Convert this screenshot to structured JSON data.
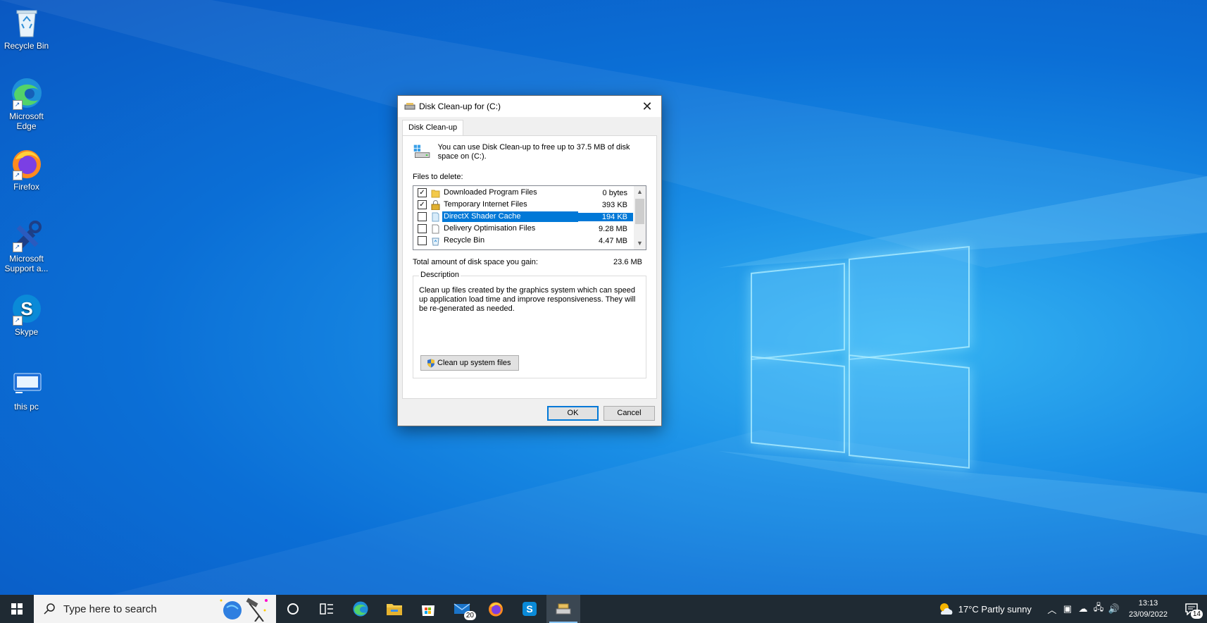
{
  "desktop": {
    "icons": [
      {
        "label": "Recycle Bin"
      },
      {
        "label": "Microsoft Edge"
      },
      {
        "label": "Firefox"
      },
      {
        "label": "Microsoft Support a..."
      },
      {
        "label": "Skype"
      },
      {
        "label": "this pc"
      }
    ]
  },
  "dialog": {
    "title": "Disk Clean-up for  (C:)",
    "tab": "Disk Clean-up",
    "intro": "You can use Disk Clean-up to free up to 37.5 MB of disk space on  (C:).",
    "files_label": "Files to delete:",
    "files": [
      {
        "name": "Downloaded Program Files",
        "size": "0 bytes",
        "checked": true
      },
      {
        "name": "Temporary Internet Files",
        "size": "393 KB",
        "checked": true
      },
      {
        "name": "DirectX Shader Cache",
        "size": "194 KB",
        "checked": false,
        "selected": true
      },
      {
        "name": "Delivery Optimisation Files",
        "size": "9.28 MB",
        "checked": false
      },
      {
        "name": "Recycle Bin",
        "size": "4.47 MB",
        "checked": false
      }
    ],
    "total_label": "Total amount of disk space you gain:",
    "total_value": "23.6 MB",
    "description_legend": "Description",
    "description": "Clean up files created by the graphics system which can speed up application load time and improve responsiveness. They will be re-generated as needed.",
    "system_button": "Clean up system files",
    "ok": "OK",
    "cancel": "Cancel"
  },
  "taskbar": {
    "search_placeholder": "Type here to search",
    "mail_badge": "20",
    "weather": "17°C  Partly sunny",
    "time": "13:13",
    "date": "23/09/2022",
    "notifications_badge": "14"
  }
}
